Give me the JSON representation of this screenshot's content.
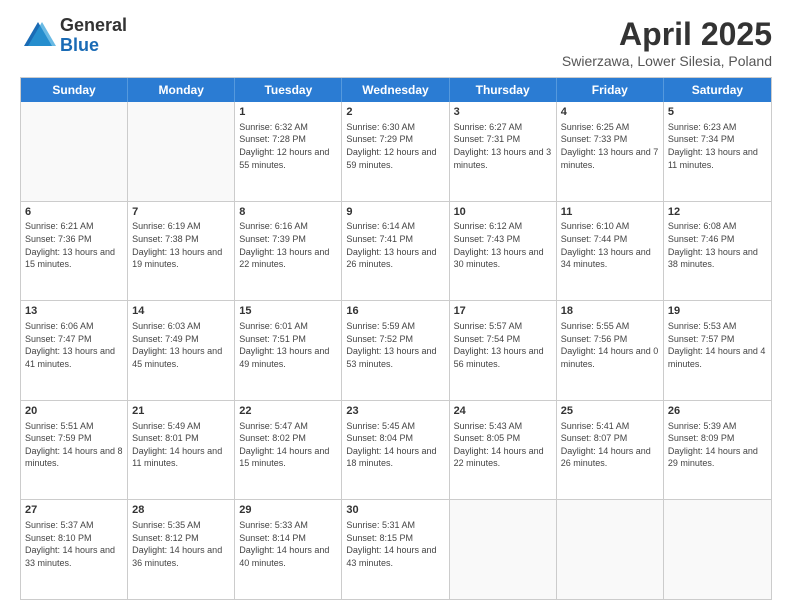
{
  "logo": {
    "general": "General",
    "blue": "Blue"
  },
  "header": {
    "month_year": "April 2025",
    "location": "Swierzawa, Lower Silesia, Poland"
  },
  "weekdays": [
    "Sunday",
    "Monday",
    "Tuesday",
    "Wednesday",
    "Thursday",
    "Friday",
    "Saturday"
  ],
  "weeks": [
    [
      {
        "day": "",
        "info": ""
      },
      {
        "day": "",
        "info": ""
      },
      {
        "day": "1",
        "info": "Sunrise: 6:32 AM\nSunset: 7:28 PM\nDaylight: 12 hours and 55 minutes."
      },
      {
        "day": "2",
        "info": "Sunrise: 6:30 AM\nSunset: 7:29 PM\nDaylight: 12 hours and 59 minutes."
      },
      {
        "day": "3",
        "info": "Sunrise: 6:27 AM\nSunset: 7:31 PM\nDaylight: 13 hours and 3 minutes."
      },
      {
        "day": "4",
        "info": "Sunrise: 6:25 AM\nSunset: 7:33 PM\nDaylight: 13 hours and 7 minutes."
      },
      {
        "day": "5",
        "info": "Sunrise: 6:23 AM\nSunset: 7:34 PM\nDaylight: 13 hours and 11 minutes."
      }
    ],
    [
      {
        "day": "6",
        "info": "Sunrise: 6:21 AM\nSunset: 7:36 PM\nDaylight: 13 hours and 15 minutes."
      },
      {
        "day": "7",
        "info": "Sunrise: 6:19 AM\nSunset: 7:38 PM\nDaylight: 13 hours and 19 minutes."
      },
      {
        "day": "8",
        "info": "Sunrise: 6:16 AM\nSunset: 7:39 PM\nDaylight: 13 hours and 22 minutes."
      },
      {
        "day": "9",
        "info": "Sunrise: 6:14 AM\nSunset: 7:41 PM\nDaylight: 13 hours and 26 minutes."
      },
      {
        "day": "10",
        "info": "Sunrise: 6:12 AM\nSunset: 7:43 PM\nDaylight: 13 hours and 30 minutes."
      },
      {
        "day": "11",
        "info": "Sunrise: 6:10 AM\nSunset: 7:44 PM\nDaylight: 13 hours and 34 minutes."
      },
      {
        "day": "12",
        "info": "Sunrise: 6:08 AM\nSunset: 7:46 PM\nDaylight: 13 hours and 38 minutes."
      }
    ],
    [
      {
        "day": "13",
        "info": "Sunrise: 6:06 AM\nSunset: 7:47 PM\nDaylight: 13 hours and 41 minutes."
      },
      {
        "day": "14",
        "info": "Sunrise: 6:03 AM\nSunset: 7:49 PM\nDaylight: 13 hours and 45 minutes."
      },
      {
        "day": "15",
        "info": "Sunrise: 6:01 AM\nSunset: 7:51 PM\nDaylight: 13 hours and 49 minutes."
      },
      {
        "day": "16",
        "info": "Sunrise: 5:59 AM\nSunset: 7:52 PM\nDaylight: 13 hours and 53 minutes."
      },
      {
        "day": "17",
        "info": "Sunrise: 5:57 AM\nSunset: 7:54 PM\nDaylight: 13 hours and 56 minutes."
      },
      {
        "day": "18",
        "info": "Sunrise: 5:55 AM\nSunset: 7:56 PM\nDaylight: 14 hours and 0 minutes."
      },
      {
        "day": "19",
        "info": "Sunrise: 5:53 AM\nSunset: 7:57 PM\nDaylight: 14 hours and 4 minutes."
      }
    ],
    [
      {
        "day": "20",
        "info": "Sunrise: 5:51 AM\nSunset: 7:59 PM\nDaylight: 14 hours and 8 minutes."
      },
      {
        "day": "21",
        "info": "Sunrise: 5:49 AM\nSunset: 8:01 PM\nDaylight: 14 hours and 11 minutes."
      },
      {
        "day": "22",
        "info": "Sunrise: 5:47 AM\nSunset: 8:02 PM\nDaylight: 14 hours and 15 minutes."
      },
      {
        "day": "23",
        "info": "Sunrise: 5:45 AM\nSunset: 8:04 PM\nDaylight: 14 hours and 18 minutes."
      },
      {
        "day": "24",
        "info": "Sunrise: 5:43 AM\nSunset: 8:05 PM\nDaylight: 14 hours and 22 minutes."
      },
      {
        "day": "25",
        "info": "Sunrise: 5:41 AM\nSunset: 8:07 PM\nDaylight: 14 hours and 26 minutes."
      },
      {
        "day": "26",
        "info": "Sunrise: 5:39 AM\nSunset: 8:09 PM\nDaylight: 14 hours and 29 minutes."
      }
    ],
    [
      {
        "day": "27",
        "info": "Sunrise: 5:37 AM\nSunset: 8:10 PM\nDaylight: 14 hours and 33 minutes."
      },
      {
        "day": "28",
        "info": "Sunrise: 5:35 AM\nSunset: 8:12 PM\nDaylight: 14 hours and 36 minutes."
      },
      {
        "day": "29",
        "info": "Sunrise: 5:33 AM\nSunset: 8:14 PM\nDaylight: 14 hours and 40 minutes."
      },
      {
        "day": "30",
        "info": "Sunrise: 5:31 AM\nSunset: 8:15 PM\nDaylight: 14 hours and 43 minutes."
      },
      {
        "day": "",
        "info": ""
      },
      {
        "day": "",
        "info": ""
      },
      {
        "day": "",
        "info": ""
      }
    ]
  ]
}
